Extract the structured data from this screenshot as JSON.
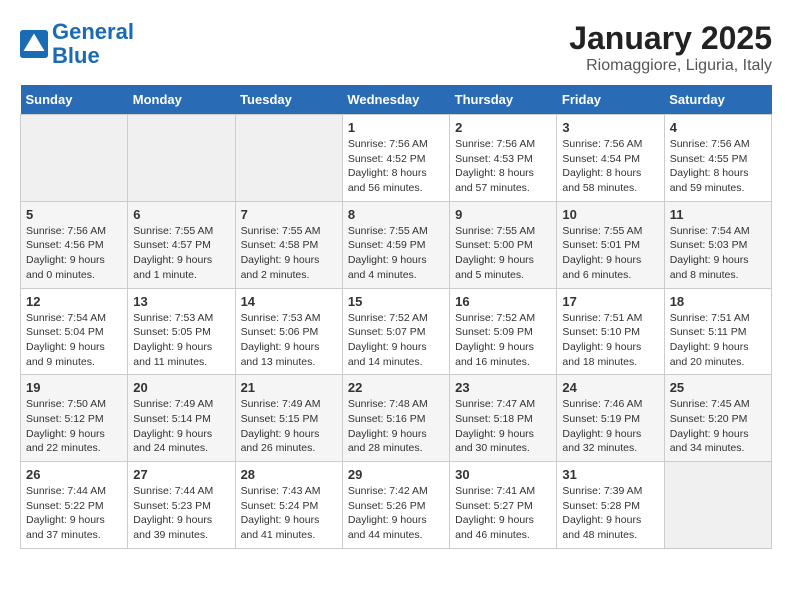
{
  "header": {
    "logo_line1": "General",
    "logo_line2": "Blue",
    "title": "January 2025",
    "subtitle": "Riomaggiore, Liguria, Italy"
  },
  "days_of_week": [
    "Sunday",
    "Monday",
    "Tuesday",
    "Wednesday",
    "Thursday",
    "Friday",
    "Saturday"
  ],
  "weeks": [
    [
      {
        "day": "",
        "info": ""
      },
      {
        "day": "",
        "info": ""
      },
      {
        "day": "",
        "info": ""
      },
      {
        "day": "1",
        "info": "Sunrise: 7:56 AM\nSunset: 4:52 PM\nDaylight: 8 hours\nand 56 minutes."
      },
      {
        "day": "2",
        "info": "Sunrise: 7:56 AM\nSunset: 4:53 PM\nDaylight: 8 hours\nand 57 minutes."
      },
      {
        "day": "3",
        "info": "Sunrise: 7:56 AM\nSunset: 4:54 PM\nDaylight: 8 hours\nand 58 minutes."
      },
      {
        "day": "4",
        "info": "Sunrise: 7:56 AM\nSunset: 4:55 PM\nDaylight: 8 hours\nand 59 minutes."
      }
    ],
    [
      {
        "day": "5",
        "info": "Sunrise: 7:56 AM\nSunset: 4:56 PM\nDaylight: 9 hours\nand 0 minutes."
      },
      {
        "day": "6",
        "info": "Sunrise: 7:55 AM\nSunset: 4:57 PM\nDaylight: 9 hours\nand 1 minute."
      },
      {
        "day": "7",
        "info": "Sunrise: 7:55 AM\nSunset: 4:58 PM\nDaylight: 9 hours\nand 2 minutes."
      },
      {
        "day": "8",
        "info": "Sunrise: 7:55 AM\nSunset: 4:59 PM\nDaylight: 9 hours\nand 4 minutes."
      },
      {
        "day": "9",
        "info": "Sunrise: 7:55 AM\nSunset: 5:00 PM\nDaylight: 9 hours\nand 5 minutes."
      },
      {
        "day": "10",
        "info": "Sunrise: 7:55 AM\nSunset: 5:01 PM\nDaylight: 9 hours\nand 6 minutes."
      },
      {
        "day": "11",
        "info": "Sunrise: 7:54 AM\nSunset: 5:03 PM\nDaylight: 9 hours\nand 8 minutes."
      }
    ],
    [
      {
        "day": "12",
        "info": "Sunrise: 7:54 AM\nSunset: 5:04 PM\nDaylight: 9 hours\nand 9 minutes."
      },
      {
        "day": "13",
        "info": "Sunrise: 7:53 AM\nSunset: 5:05 PM\nDaylight: 9 hours\nand 11 minutes."
      },
      {
        "day": "14",
        "info": "Sunrise: 7:53 AM\nSunset: 5:06 PM\nDaylight: 9 hours\nand 13 minutes."
      },
      {
        "day": "15",
        "info": "Sunrise: 7:52 AM\nSunset: 5:07 PM\nDaylight: 9 hours\nand 14 minutes."
      },
      {
        "day": "16",
        "info": "Sunrise: 7:52 AM\nSunset: 5:09 PM\nDaylight: 9 hours\nand 16 minutes."
      },
      {
        "day": "17",
        "info": "Sunrise: 7:51 AM\nSunset: 5:10 PM\nDaylight: 9 hours\nand 18 minutes."
      },
      {
        "day": "18",
        "info": "Sunrise: 7:51 AM\nSunset: 5:11 PM\nDaylight: 9 hours\nand 20 minutes."
      }
    ],
    [
      {
        "day": "19",
        "info": "Sunrise: 7:50 AM\nSunset: 5:12 PM\nDaylight: 9 hours\nand 22 minutes."
      },
      {
        "day": "20",
        "info": "Sunrise: 7:49 AM\nSunset: 5:14 PM\nDaylight: 9 hours\nand 24 minutes."
      },
      {
        "day": "21",
        "info": "Sunrise: 7:49 AM\nSunset: 5:15 PM\nDaylight: 9 hours\nand 26 minutes."
      },
      {
        "day": "22",
        "info": "Sunrise: 7:48 AM\nSunset: 5:16 PM\nDaylight: 9 hours\nand 28 minutes."
      },
      {
        "day": "23",
        "info": "Sunrise: 7:47 AM\nSunset: 5:18 PM\nDaylight: 9 hours\nand 30 minutes."
      },
      {
        "day": "24",
        "info": "Sunrise: 7:46 AM\nSunset: 5:19 PM\nDaylight: 9 hours\nand 32 minutes."
      },
      {
        "day": "25",
        "info": "Sunrise: 7:45 AM\nSunset: 5:20 PM\nDaylight: 9 hours\nand 34 minutes."
      }
    ],
    [
      {
        "day": "26",
        "info": "Sunrise: 7:44 AM\nSunset: 5:22 PM\nDaylight: 9 hours\nand 37 minutes."
      },
      {
        "day": "27",
        "info": "Sunrise: 7:44 AM\nSunset: 5:23 PM\nDaylight: 9 hours\nand 39 minutes."
      },
      {
        "day": "28",
        "info": "Sunrise: 7:43 AM\nSunset: 5:24 PM\nDaylight: 9 hours\nand 41 minutes."
      },
      {
        "day": "29",
        "info": "Sunrise: 7:42 AM\nSunset: 5:26 PM\nDaylight: 9 hours\nand 44 minutes."
      },
      {
        "day": "30",
        "info": "Sunrise: 7:41 AM\nSunset: 5:27 PM\nDaylight: 9 hours\nand 46 minutes."
      },
      {
        "day": "31",
        "info": "Sunrise: 7:39 AM\nSunset: 5:28 PM\nDaylight: 9 hours\nand 48 minutes."
      },
      {
        "day": "",
        "info": ""
      }
    ]
  ]
}
